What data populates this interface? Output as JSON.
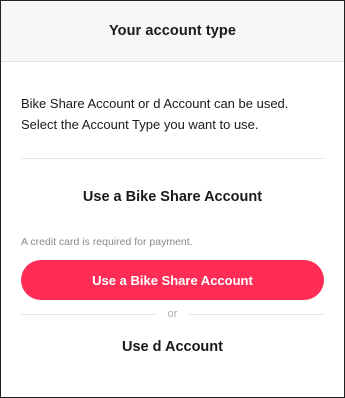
{
  "header": {
    "title": "Your account type"
  },
  "intro": {
    "line1": "Bike Share Account or d Account can be used.",
    "line2": "Select the Account Type you want to use."
  },
  "bike_share": {
    "heading": "Use a Bike Share Account",
    "note": "A credit card is required for payment.",
    "button_label": "Use a Bike Share Account"
  },
  "separator": {
    "label": "or"
  },
  "d_account": {
    "heading": "Use d Account"
  },
  "colors": {
    "accent": "#ff2d55",
    "header_bg": "#f6f6f6",
    "muted_text": "#8a8a8a"
  }
}
